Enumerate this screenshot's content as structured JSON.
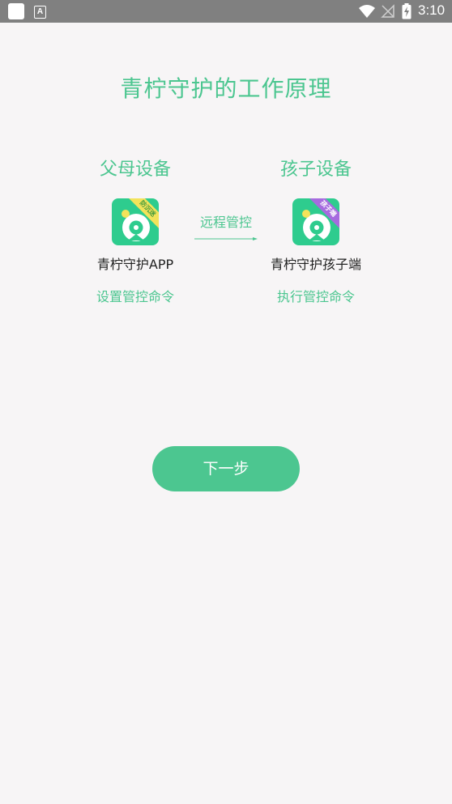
{
  "status_bar": {
    "time": "3:10",
    "icons": [
      "app-square-icon",
      "a-notification-icon",
      "wifi-icon",
      "no-signal-icon",
      "battery-charging-icon"
    ]
  },
  "page": {
    "title": "青柠守护的工作原理"
  },
  "parent": {
    "device_title": "父母设备",
    "app_name": "青柠守护APP",
    "command": "设置管控命令",
    "badge": "防沉迷"
  },
  "child": {
    "device_title": "孩子设备",
    "app_name": "青柠守护孩子端",
    "command": "执行管控命令",
    "badge": "孩子端"
  },
  "connector": {
    "label": "远程管控"
  },
  "actions": {
    "next_label": "下一步"
  },
  "colors": {
    "accent": "#4cc690",
    "icon_bg": "#2ecc8e",
    "background": "#f7f5f6",
    "status_bar": "#808080",
    "parent_badge": "#f3e35a",
    "child_badge": "#a66bdf"
  }
}
